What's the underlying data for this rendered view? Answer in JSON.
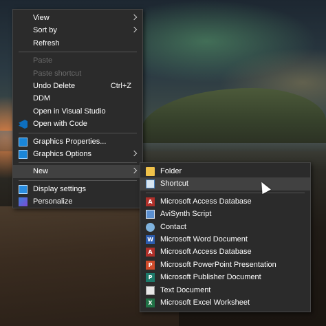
{
  "context_menu": {
    "items": [
      {
        "label": "View",
        "submenu": true
      },
      {
        "label": "Sort by",
        "submenu": true
      },
      {
        "label": "Refresh"
      },
      {
        "label": "Paste",
        "disabled": true
      },
      {
        "label": "Paste shortcut",
        "disabled": true
      },
      {
        "label": "Undo Delete",
        "shortcut": "Ctrl+Z"
      },
      {
        "label": "DDM"
      },
      {
        "label": "Open in Visual Studio"
      },
      {
        "label": "Open with Code",
        "icon": "vscode-icon"
      },
      {
        "label": "Graphics Properties...",
        "icon": "graphics-icon"
      },
      {
        "label": "Graphics Options",
        "icon": "graphics-icon",
        "submenu": true
      },
      {
        "label": "New",
        "submenu": true,
        "expanded": true
      },
      {
        "label": "Display settings",
        "icon": "display-icon"
      },
      {
        "label": "Personalize",
        "icon": "personalize-icon"
      }
    ]
  },
  "new_submenu": {
    "items": [
      {
        "label": "Folder",
        "icon": "folder-icon"
      },
      {
        "label": "Shortcut",
        "icon": "shortcut-icon",
        "hover": true
      },
      {
        "label": "Microsoft Access Database",
        "icon": "access-icon"
      },
      {
        "label": "AviSynth Script",
        "icon": "avisynth-icon"
      },
      {
        "label": "Contact",
        "icon": "contact-icon"
      },
      {
        "label": "Microsoft Word Document",
        "icon": "word-icon"
      },
      {
        "label": "Microsoft Access Database",
        "icon": "access-icon"
      },
      {
        "label": "Microsoft PowerPoint Presentation",
        "icon": "powerpoint-icon"
      },
      {
        "label": "Microsoft Publisher Document",
        "icon": "publisher-icon"
      },
      {
        "label": "Text Document",
        "icon": "text-document-icon"
      },
      {
        "label": "Microsoft Excel Worksheet",
        "icon": "excel-icon"
      }
    ]
  },
  "colors": {
    "menu_bg": "#2b2b2b",
    "menu_border": "#474747",
    "hover_bg": "#414141",
    "disabled_text": "#6d6d6d",
    "text": "#ffffff"
  }
}
